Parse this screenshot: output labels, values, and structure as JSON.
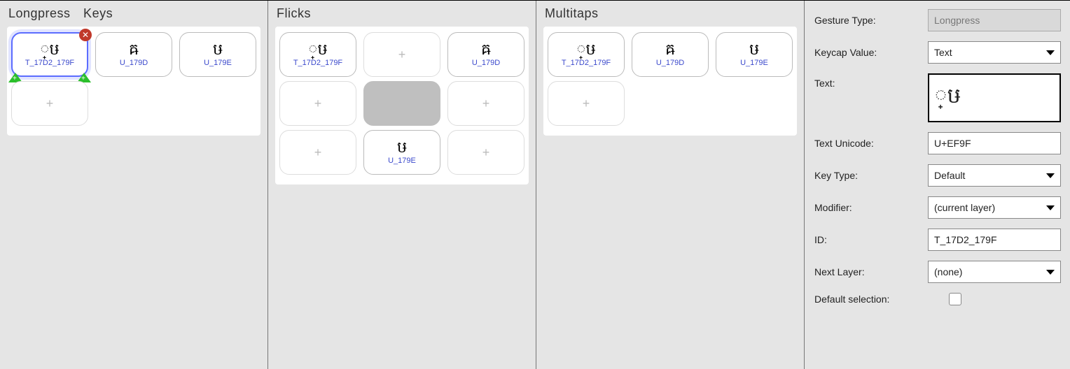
{
  "panels": {
    "longpress": {
      "heading": "Longpress Keys",
      "keys": [
        {
          "glyph": "្ឞ",
          "code": "T_17D2_179F",
          "selected": true
        },
        {
          "glyph": "ឝ",
          "code": "U_179D"
        },
        {
          "glyph": "ឞ",
          "code": "U_179E"
        }
      ]
    },
    "flicks": {
      "heading": "Flicks",
      "grid": {
        "nw": {
          "glyph": "្ឞ",
          "code": "T_17D2_179F"
        },
        "n": {
          "add": true
        },
        "ne": {
          "glyph": "ឝ",
          "code": "U_179D"
        },
        "w": {
          "add": true
        },
        "c": {
          "disabled": true
        },
        "e": {
          "add": true
        },
        "sw": {
          "add": true
        },
        "s": {
          "glyph": "ឞ",
          "code": "U_179E"
        },
        "se": {
          "add": true
        }
      }
    },
    "multitaps": {
      "heading": "Multitaps",
      "keys": [
        {
          "glyph": "្ឞ",
          "code": "T_17D2_179F"
        },
        {
          "glyph": "ឝ",
          "code": "U_179D"
        },
        {
          "glyph": "ឞ",
          "code": "U_179E"
        }
      ]
    }
  },
  "props": {
    "labels": {
      "gesture_type": "Gesture Type:",
      "keycap_value": "Keycap Value:",
      "text": "Text:",
      "text_unicode": "Text Unicode:",
      "key_type": "Key Type:",
      "modifier": "Modifier:",
      "id": "ID:",
      "next_layer": "Next Layer:",
      "default_selection": "Default selection:"
    },
    "values": {
      "gesture_type": "Longpress",
      "keycap_value": "Text",
      "text": "្ឞ",
      "text_unicode": "U+EF9F",
      "key_type": "Default",
      "modifier": "(current layer)",
      "id": "T_17D2_179F",
      "next_layer": "(none)"
    }
  },
  "icons": {
    "plus": "+",
    "close": "✕"
  }
}
